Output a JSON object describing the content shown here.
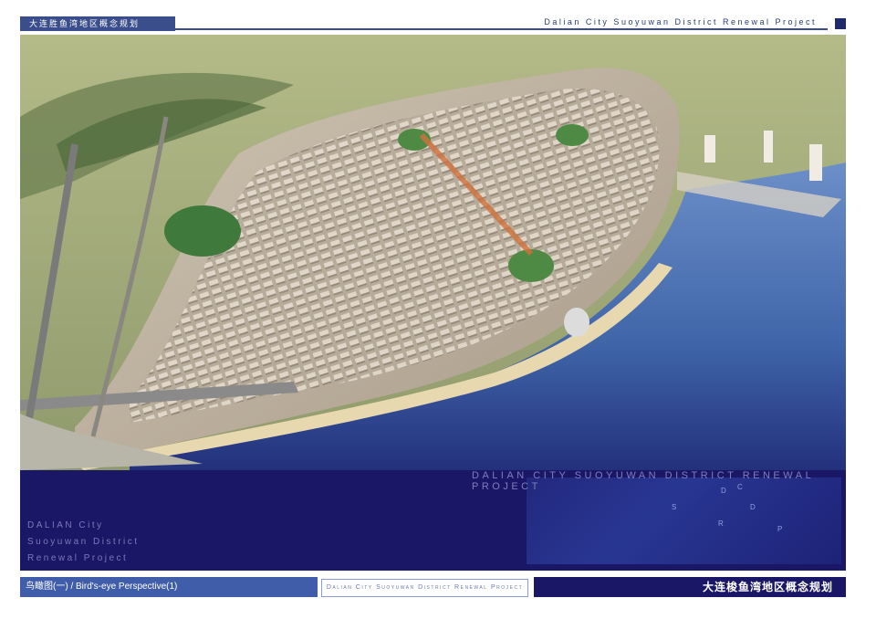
{
  "header": {
    "left_tag": "大连胜鱼湾地区概念规划",
    "right_title": "Dalian City Suoyuwan District Renewal Project"
  },
  "band": {
    "big_title": "DALIAN CITY SUOYUWAN DISTRICT RENEWAL PROJECT",
    "side_lines": [
      "DALIAN City",
      "Suoyuwan District",
      "Renewal Project"
    ],
    "letters": [
      "D",
      "C",
      "S",
      "D",
      "R",
      "P"
    ]
  },
  "footer": {
    "caption": "鸟瞰图(一) / Bird's-eye Perspective(1)",
    "mid_text": "Dalian City Suoyuwan District Renewal Project",
    "right_title": "大连梭鱼湾地区概念规划"
  },
  "colors": {
    "navy": "#1b1767",
    "accent_blue": "#3f5da8",
    "water": "#4f78b8",
    "terrain": "#a7b07c"
  }
}
